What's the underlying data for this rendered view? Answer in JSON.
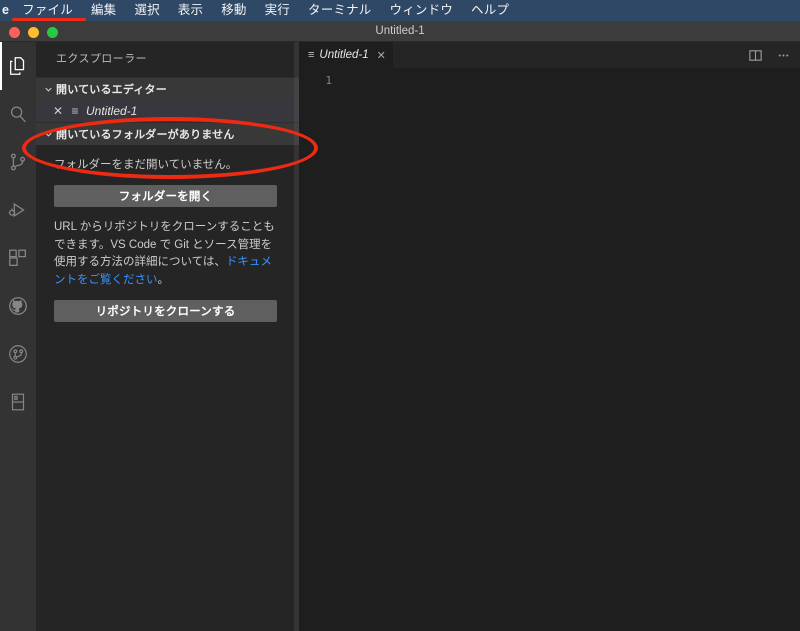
{
  "menubar": {
    "app_name": "e",
    "items": [
      {
        "label": "ファイル",
        "underlined": true
      },
      {
        "label": "編集",
        "underlined": false
      },
      {
        "label": "選択",
        "underlined": false
      },
      {
        "label": "表示",
        "underlined": false
      },
      {
        "label": "移動",
        "underlined": false
      },
      {
        "label": "実行",
        "underlined": false
      },
      {
        "label": "ターミナル",
        "underlined": false
      },
      {
        "label": "ウィンドウ",
        "underlined": false
      },
      {
        "label": "ヘルプ",
        "underlined": false
      }
    ]
  },
  "window": {
    "title": "Untitled-1",
    "traffic_lights": [
      "close",
      "minimize",
      "maximize"
    ]
  },
  "activitybar": {
    "items": [
      {
        "name": "explorer",
        "icon": "files-icon",
        "active": true
      },
      {
        "name": "search",
        "icon": "search-icon",
        "active": false
      },
      {
        "name": "source-control",
        "icon": "source-control-icon",
        "active": false
      },
      {
        "name": "run-and-debug",
        "icon": "run-debug-icon",
        "active": false
      },
      {
        "name": "extensions",
        "icon": "extensions-icon",
        "active": false
      },
      {
        "name": "github",
        "icon": "github-icon",
        "active": false
      },
      {
        "name": "pull-requests",
        "icon": "git-pull-request-icon",
        "active": false
      },
      {
        "name": "docs",
        "icon": "book-icon",
        "active": false
      }
    ]
  },
  "sidebar": {
    "title": "エクスプローラー",
    "open_editors": {
      "header": "開いているエディター",
      "rows": [
        {
          "name": "Untitled-1",
          "close": "✕",
          "icon": "≡"
        }
      ]
    },
    "no_folder": {
      "header": "開いているフォルダーがありません",
      "message": "フォルダーをまだ開いていません。",
      "open_folder_button": "フォルダーを開く",
      "clone_text_1": "URL からリポジトリをクローンすることもできます。",
      "clone_text_2": "VS Code で Git とソース管理を使用する方法の詳細については、",
      "clone_link": "ドキュメントをご覧ください",
      "clone_text_3": "。",
      "clone_button": "リポジトリをクローンする"
    }
  },
  "editor": {
    "tab": {
      "label": "Untitled-1",
      "icon": "≡",
      "close": "✕"
    },
    "actions": [
      {
        "name": "split-editor",
        "icon": "split-editor-icon"
      },
      {
        "name": "more-actions",
        "icon": "ellipsis-icon"
      }
    ],
    "line_numbers": [
      "1"
    ],
    "content": ""
  },
  "annotation": {
    "type": "ellipse",
    "color": "#ee2a12",
    "target": "フォルダーを開く"
  },
  "colors": {
    "menubar_bg": "#2e4866",
    "titlebar_bg": "#3c3c3c",
    "activitybar_bg": "#333333",
    "sidebar_bg": "#252526",
    "editor_bg": "#1e1e1e",
    "accent_link": "#3794ff",
    "annotation_red": "#ee2a12"
  }
}
